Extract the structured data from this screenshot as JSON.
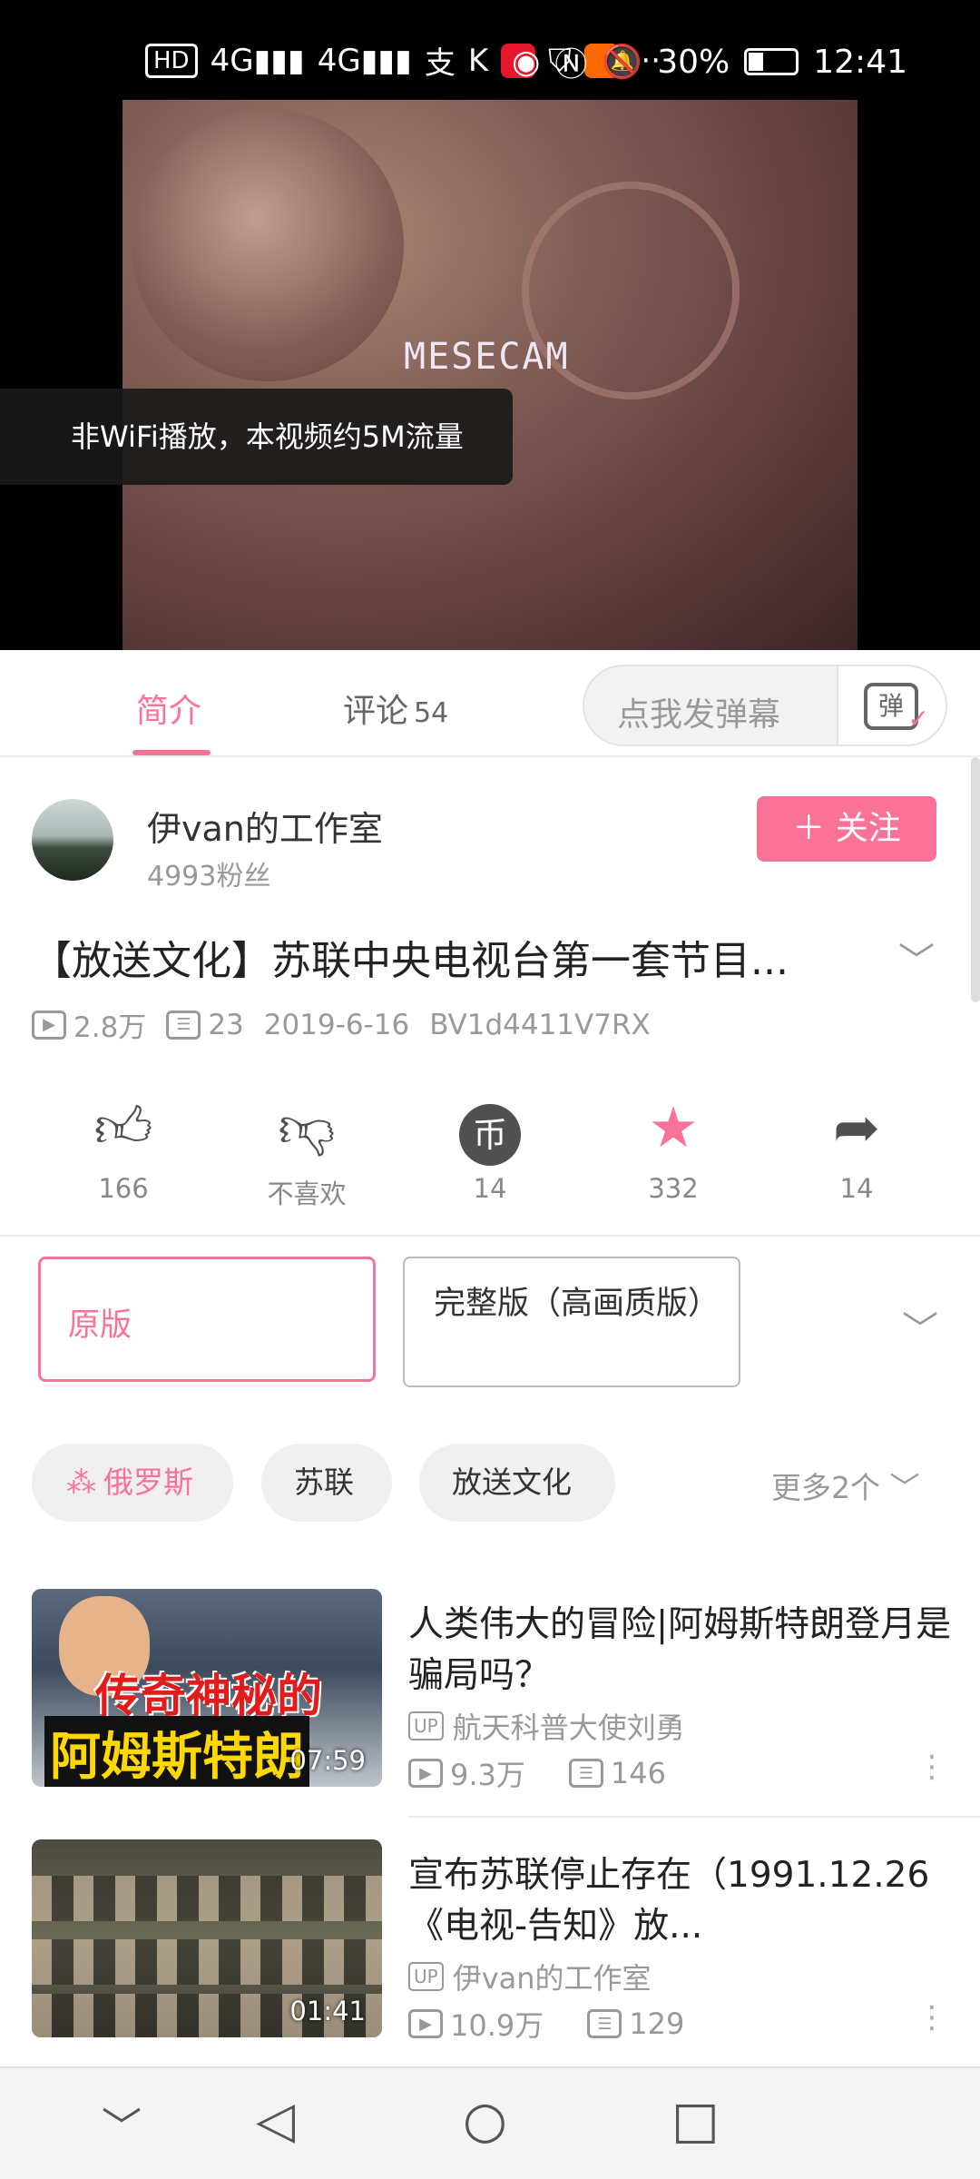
{
  "status_bar": {
    "left_indicators": [
      "HD",
      "4G",
      "4G"
    ],
    "battery": "30%",
    "battery_level": 0.3,
    "time": "12:41"
  },
  "video": {
    "overlay_text": "MESECAM",
    "toast": "非WiFi播放，本视频约5M流量"
  },
  "tabs": {
    "intro": "简介",
    "comments": "评论",
    "comments_count": "54",
    "danmaku_placeholder": "点我发弹幕",
    "danmaku_icon": "弹"
  },
  "uploader": {
    "name": "伊van的工作室",
    "fans": "4993粉丝",
    "follow_label": "＋ 关注"
  },
  "video_info": {
    "title": "【放送文化】苏联中央电视台第一套节目...",
    "views": "2.8万",
    "danmaku": "23",
    "date": "2019-6-16",
    "bvid": "BV1d4411V7RX"
  },
  "actions": {
    "like": "166",
    "dislike": "不喜欢",
    "coin": "14",
    "favorite": "332",
    "share": "14"
  },
  "versions": {
    "original": "原版",
    "hd": "完整版（高画质版）"
  },
  "tags": {
    "russia": "俄罗斯",
    "soviet": "苏联",
    "hoso": "放送文化",
    "more": "更多2个"
  },
  "recommendations": [
    {
      "title": "人类伟大的冒险|阿姆斯特朗登月是骗局吗？",
      "uploader": "航天科普大使刘勇",
      "views": "9.3万",
      "danmaku": "146",
      "duration": "07:59",
      "thumb_text1": "传奇神秘的",
      "thumb_text2": "阿姆斯特朗"
    },
    {
      "title": "宣布苏联停止存在（1991.12.26《电视-告知》放...",
      "uploader": "伊van的工作室",
      "views": "10.9万",
      "danmaku": "129",
      "duration": "01:41"
    }
  ],
  "badges": {
    "up": "UP"
  }
}
